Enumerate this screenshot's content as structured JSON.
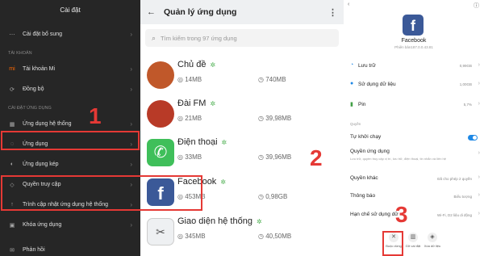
{
  "left": {
    "title": "Cài đặt",
    "top_item": "Cài đặt bổ sung",
    "section_account": "TÀI KHOẢN",
    "account_items": [
      "Tài khoản Mi",
      "Đồng bộ"
    ],
    "section_apps": "CÀI ĐẶT ỨNG DỤNG",
    "app_items": [
      "Ứng dụng hệ thống",
      "Ứng dụng",
      "Ứng dụng kép",
      "Quyền truy cập",
      "Trình cập nhật ứng dụng hệ thống",
      "Khóa ứng dụng"
    ],
    "bottom_item": "Phản hồi"
  },
  "mid": {
    "title": "Quản lý ứng dụng",
    "search_placeholder": "Tìm kiếm trong 97 ứng dụng",
    "apps": [
      {
        "name": "Chủ đề",
        "size": "14MB",
        "cache": "740MB"
      },
      {
        "name": "Đài FM",
        "size": "21MB",
        "cache": "39,98MB"
      },
      {
        "name": "Điện thoại",
        "size": "33MB",
        "cache": "39,96MB"
      },
      {
        "name": "Facebook",
        "size": "453MB",
        "cache": "0,98GB"
      },
      {
        "name": "Giao diện hệ thống",
        "size": "345MB",
        "cache": "40,50MB"
      }
    ]
  },
  "right": {
    "app_name": "Facebook",
    "version": "Phiên bản187.0.0.43.81",
    "rows": [
      {
        "label": "Lưu trữ",
        "value": "0,99GB"
      },
      {
        "label": "Sử dụng dữ liệu",
        "value": "1,00GB"
      },
      {
        "label": "Pin",
        "value": "5,7%"
      }
    ],
    "section_perm": "Quyền",
    "autostart": "Tự khởi chạy",
    "perm_label": "Quyền ứng dụng",
    "perm_sub": "Lưu trữ, quyền truy cập vị trí, lưu trữ, điện thoại, tin nhắn và liên hệ",
    "other_perm": "Quyền khác",
    "other_perm_value": "Đã cho phép 2 quyền",
    "notif": "Thông báo",
    "notif_value": "Biểu tượng",
    "limit": "Hạn chế sử dụng dữ",
    "limit_value": "Wi-Fi, D2 liệu di động",
    "buttons": [
      "Buộc dừng",
      "Gỡ cài đặt",
      "Xóa dữ liệu"
    ]
  },
  "markers": [
    "1",
    "2",
    "3"
  ],
  "colors": {
    "highlight": "#e53935",
    "facebook": "#3b5998",
    "accent": "#1e88e5"
  }
}
